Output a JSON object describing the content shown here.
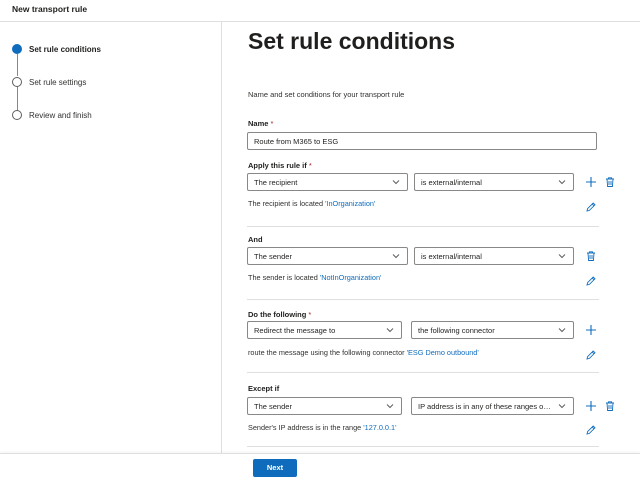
{
  "window": {
    "title": "New transport rule"
  },
  "steps": [
    {
      "label": "Set rule conditions",
      "state": "active"
    },
    {
      "label": "Set rule settings",
      "state": "pending"
    },
    {
      "label": "Review and finish",
      "state": "pending"
    }
  ],
  "page": {
    "title": "Set rule conditions",
    "description": "Name and set conditions for your transport rule"
  },
  "name_field": {
    "label": "Name",
    "required_mark": "*",
    "value": "Route from M365 to ESG"
  },
  "apply_if": {
    "label": "Apply this rule if",
    "required_mark": "*",
    "condition": "The recipient",
    "operator": "is external/internal",
    "info_text": "The recipient is located",
    "info_link": "'InOrganization'"
  },
  "and_cond": {
    "label": "And",
    "condition": "The sender",
    "operator": "is external/internal",
    "info_text": "The sender is located",
    "info_link": "'NotInOrganization'"
  },
  "do_following": {
    "label": "Do the following",
    "required_mark": "*",
    "action": "Redirect the message to",
    "target": "the following connector",
    "info_text": "route the message using the following connector",
    "info_link": "'ESG Demo outbound'"
  },
  "except_if": {
    "label": "Except if",
    "condition": "The sender",
    "operator": "IP address is in any of these ranges or ...",
    "info_text": "Sender's IP address is in the range",
    "info_link": "'127.0.0.1'"
  },
  "footer": {
    "next_label": "Next"
  },
  "colors": {
    "accent": "#0f6cbd",
    "required": "#a4262c",
    "border": "#8a8886"
  },
  "icons": {
    "add": "plus-icon",
    "delete": "trash-icon",
    "edit": "pencil-icon",
    "dropdown": "chevron-down-icon"
  }
}
